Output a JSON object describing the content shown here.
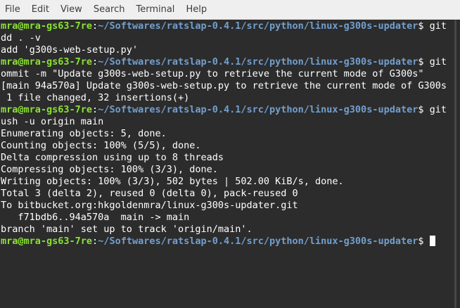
{
  "menubar": {
    "items": [
      "File",
      "Edit",
      "View",
      "Search",
      "Terminal",
      "Help"
    ]
  },
  "prompt": {
    "user": "mra@mra-gs63-7re",
    "path": "~/Softwares/ratslap-0.4.1/src/python/linux-g300s-updater",
    "symbol": "$"
  },
  "terminal": {
    "lines": [
      {
        "kind": "prompt",
        "cmd": " git a"
      },
      {
        "kind": "out",
        "text": "dd . -v"
      },
      {
        "kind": "out",
        "text": "add 'g300s-web-setup.py'"
      },
      {
        "kind": "prompt",
        "cmd": " git c"
      },
      {
        "kind": "out",
        "text": "ommit -m \"Update g300s-web-setup.py to retrieve the current mode of G300s\""
      },
      {
        "kind": "out",
        "text": "[main 94a570a] Update g300s-web-setup.py to retrieve the current mode of G300s"
      },
      {
        "kind": "out",
        "text": " 1 file changed, 32 insertions(+)"
      },
      {
        "kind": "prompt",
        "cmd": " git p"
      },
      {
        "kind": "out",
        "text": "ush -u origin main"
      },
      {
        "kind": "out",
        "text": "Enumerating objects: 5, done."
      },
      {
        "kind": "out",
        "text": "Counting objects: 100% (5/5), done."
      },
      {
        "kind": "out",
        "text": "Delta compression using up to 8 threads"
      },
      {
        "kind": "out",
        "text": "Compressing objects: 100% (3/3), done."
      },
      {
        "kind": "out",
        "text": "Writing objects: 100% (3/3), 502 bytes | 502.00 KiB/s, done."
      },
      {
        "kind": "out",
        "text": "Total 3 (delta 2), reused 0 (delta 0), pack-reused 0"
      },
      {
        "kind": "out",
        "text": "To bitbucket.org:hkgoldenmra/linux-g300s-updater.git"
      },
      {
        "kind": "out",
        "text": "   f71bdb6..94a570a  main -> main"
      },
      {
        "kind": "out",
        "text": "branch 'main' set up to track 'origin/main'."
      },
      {
        "kind": "prompt",
        "cmd": " ",
        "cursor": true
      }
    ]
  },
  "colors": {
    "background": "#2c2c2c",
    "user": "#8ae234",
    "path": "#729fcf",
    "text": "#ffffff",
    "menubar": "#efefef"
  }
}
